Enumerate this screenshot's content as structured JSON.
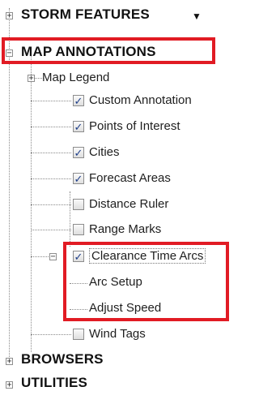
{
  "sections": {
    "storm_features": "STORM FEATURES",
    "map_annotations": "MAP ANNOTATIONS",
    "browsers": "BROWSERS",
    "utilities": "UTILITIES"
  },
  "map_legend": {
    "label": "Map Legend"
  },
  "items": [
    {
      "label": "Custom Annotation",
      "checked": true
    },
    {
      "label": "Points of Interest",
      "checked": true
    },
    {
      "label": "Cities",
      "checked": true
    },
    {
      "label": "Forecast Areas",
      "checked": true
    },
    {
      "label": "Distance Ruler",
      "checked": false
    },
    {
      "label": "Range Marks",
      "checked": false
    },
    {
      "label": "Clearance Time Arcs",
      "checked": true
    },
    {
      "label": "Wind Tags",
      "checked": false
    }
  ],
  "clearance_children": {
    "arc_setup": "Arc Setup",
    "adjust_speed": "Adjust Speed"
  },
  "glyphs": {
    "plus": "+",
    "minus": "−",
    "check": "✓",
    "caret": "▼"
  },
  "colors": {
    "highlight": "#e11b24"
  }
}
